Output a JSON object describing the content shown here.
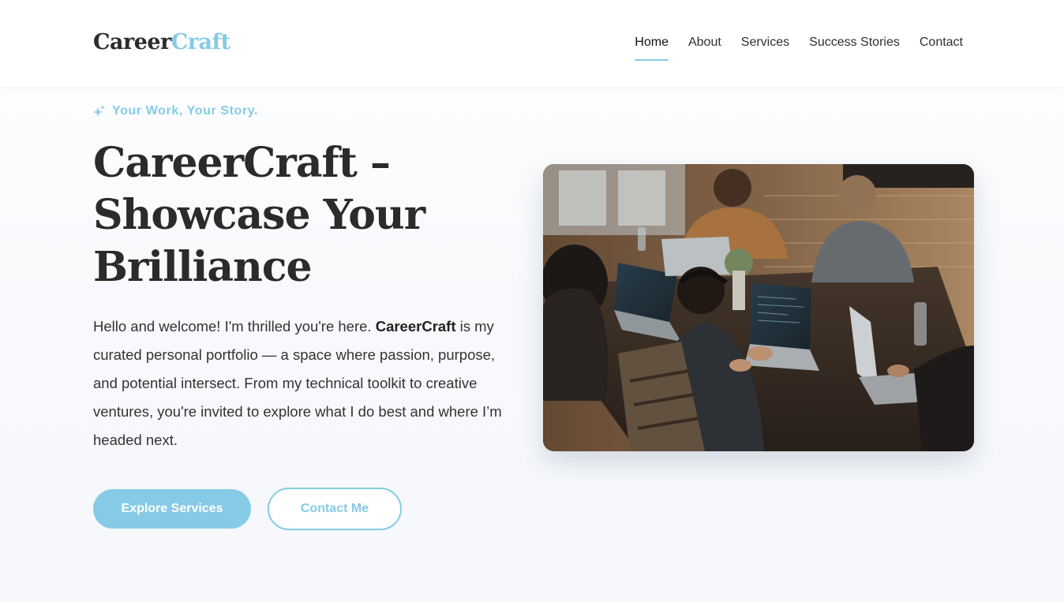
{
  "brand": {
    "logo_part_a": "Career",
    "logo_part_b": "Craft"
  },
  "nav": {
    "items": [
      {
        "label": "Home",
        "active": true
      },
      {
        "label": "About",
        "active": false
      },
      {
        "label": "Services",
        "active": false
      },
      {
        "label": "Success Stories",
        "active": false
      },
      {
        "label": "Contact",
        "active": false
      }
    ]
  },
  "hero": {
    "tagline": "Your Work, Your Story.",
    "tagline_icon": "sparkle-icon",
    "title": "CareerCraft – Showcase Your Brilliance",
    "intro_before": "Hello and welcome! I'm thrilled you're here. ",
    "intro_bold": "CareerCraft",
    "intro_after": " is my curated personal portfolio — a space where passion, purpose, and potential intersect. From my technical toolkit to creative ventures, you're invited to explore what I do best and where I’m headed next.",
    "primary_button": "Explore Services",
    "secondary_button": "Contact Me",
    "image_subject": "team-working-on-laptops-photo"
  },
  "colors": {
    "accent": "#86cbe6",
    "text": "#2b2b2b",
    "background": "#f7f9fc"
  }
}
